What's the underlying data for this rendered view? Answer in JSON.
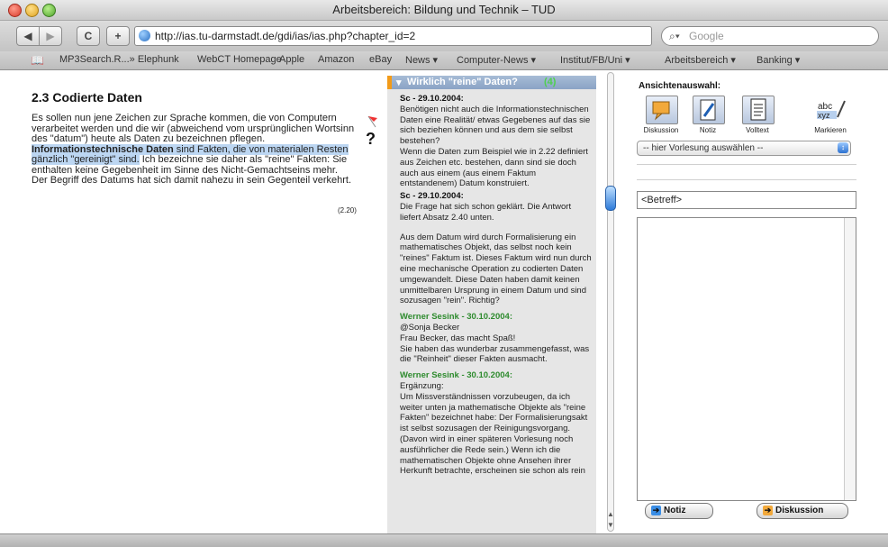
{
  "window": {
    "title": "Arbeitsbereich: Bildung und Technik – TUD"
  },
  "toolbar": {
    "back": "◀",
    "forward": "▶",
    "reload": "C",
    "add": "+",
    "url": "http://ias.tu-darmstadt.de/gdi/ias/ias.php?chapter_id=2",
    "search_placeholder": "Google"
  },
  "bookmarks": {
    "book_icon": "book-icon",
    "items": [
      "MP3Search.R...» Elephunk",
      "WebCT Homepage",
      "Apple",
      "Amazon",
      "eBay",
      "News ▾",
      "Computer-News ▾",
      "Institut/FB/Uni ▾",
      "Arbeitsbereich ▾",
      "Banking ▾"
    ]
  },
  "article": {
    "heading": "2.3 Codierte Daten",
    "p_a": "Es sollen nun jene Zeichen zur Sprache kommen, die von Computern verarbeitet werden und die wir (abweichend vom ursprünglichen Wortsinn des \"datum\") heute als Daten zu bezeichnen pflegen. ",
    "p_hl_bold": "Informationstechnische Daten",
    "p_hl_mid": " sind Fakten, die von materialen Resten gänzlich \"gereinigt\" sind.",
    "p_b": " Ich bezeichne sie daher als \"reine\" Fakten: Sie enthalten keine Gegebenheit im Sinne des Nicht-Gemachtseins mehr. Der Begriff des Datums hat sich damit nahezu in sein Gegenteil verkehrt.",
    "ref": "(2.20)",
    "flag_icon": "flag-icon",
    "question": "?"
  },
  "discussion": {
    "title": "Wirklich \"reine\" Daten?",
    "count": "(4)",
    "posts": [
      {
        "author": "Sc                - 29.10.2004:",
        "text": [
          "Benötigen nicht auch die Informationstechnischen Daten eine Realität/ etwas Gegebenes auf das sie sich beziehen können und aus dem sie selbst bestehen?",
          "Wenn die Daten zum Beispiel wie in 2.22 definiert aus Zeichen etc. bestehen, dann sind sie doch auch aus einem (aus einem Faktum entstandenem) Datum konstruiert."
        ]
      },
      {
        "author": "Sc                - 29.10.2004:",
        "text": [
          "Die Frage hat sich schon geklärt. Die Antwort liefert Absatz 2.40 unten.",
          "",
          "Aus dem Datum wird durch Formalisierung ein mathematisches Objekt, das selbst noch kein \"reines\" Faktum ist. Dieses Faktum wird nun durch eine mechanische Operation zu codierten Daten umgewandelt. Diese Daten haben damit keinen unmittelbaren Ursprung in einem Datum und sind sozusagen \"rein\". Richtig?"
        ]
      },
      {
        "author": "Werner Sesink - 30.10.2004:",
        "text": [
          "@Sonja Becker",
          "Frau Becker, das macht Spaß!",
          "Sie haben das wunderbar zusammengefasst, was die \"Reinheit\" dieser Fakten ausmacht."
        ]
      },
      {
        "author": "Werner Sesink - 30.10.2004:",
        "text": [
          "Ergänzung:",
          "Um Missverständnissen vorzubeugen, da ich weiter unten ja mathematische Objekte als \"reine Fakten\" bezeichnet habe: Der Formalisierungsakt ist selbst sozusagen der Reinigungsvorgang. (Davon wird in einer späteren Vorlesung noch ausführlicher die Rede sein.) Wenn ich die mathematischen Objekte ohne Ansehen ihrer Herkunft betrachte, erscheinen sie schon als rein"
        ]
      }
    ]
  },
  "panel": {
    "label": "Ansichtenauswahl:",
    "views": [
      "Diskussion",
      "Notiz",
      "Volltext",
      "Markieren"
    ],
    "select_value": "-- hier Vorlesung auswählen --",
    "subject_placeholder": "<Betreff>",
    "btn_notiz": "Notiz",
    "btn_diskussion": "Diskussion",
    "colors": {
      "green": "#2e8b2e",
      "accent": "#2c71d0",
      "orange": "#f29b1a"
    }
  }
}
